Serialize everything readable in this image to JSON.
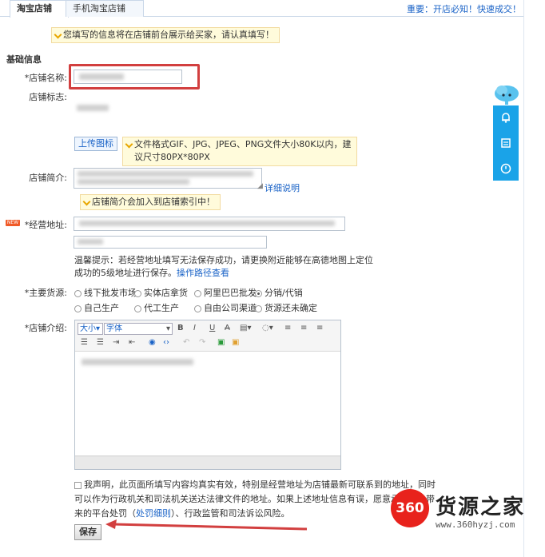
{
  "tabs": [
    {
      "label": "淘宝店铺"
    },
    {
      "label": "手机淘宝店铺"
    }
  ],
  "top_notice": "重要：开店必知！快速成交！",
  "info_tip": "您填写的信息将在店铺前台展示给买家，请认真填写！",
  "section_title": "基础信息",
  "fields": {
    "shop_name_label": "*店铺名称:",
    "shop_logo_label": "店铺标志:",
    "upload_button": "上传图标",
    "upload_tip": "文件格式GIF、JPG、JPEG、PNG文件大小80K以内，建议尺寸80PX*80PX",
    "shop_intro_label": "店铺简介:",
    "detail_link": "详细说明",
    "intro_tip": "店铺简介会加入到店铺索引中！",
    "address_label": "*经营地址:",
    "address_hint": "温馨提示：若经营地址填写无法保存成功，请更换附近能够在高德地图上定位成功的5级地址进行保存。",
    "address_hint_link": "操作路径查看",
    "source_label": "*主要货源:",
    "description_label": "*店铺介绍:"
  },
  "source_options": [
    {
      "label": "线下批发市场",
      "checked": false
    },
    {
      "label": "实体店拿货",
      "checked": false
    },
    {
      "label": "阿里巴巴批发",
      "checked": false
    },
    {
      "label": "分销/代销",
      "checked": true
    },
    {
      "label": "自己生产",
      "checked": false
    },
    {
      "label": "代工生产",
      "checked": false
    },
    {
      "label": "自由公司渠道",
      "checked": false
    },
    {
      "label": "货源还未确定",
      "checked": false
    }
  ],
  "editor": {
    "size_label": "大小",
    "font_label": "字体"
  },
  "declaration": {
    "text": "我声明，此页面所填写内容均真实有效，特别是经营地址为店铺最新可联系到的地址，同时可以作为行政机关和司法机关送达法律文件的地址。如果上述地址信息有误，愿意承担由此带来的平台处罚（",
    "link": "处罚细则",
    "text_end": "）、行政监管和司法诉讼风险。"
  },
  "save_button": "保存",
  "watermark": {
    "logo": "360",
    "name": "货源之家",
    "url": "www.360hyzj.com"
  },
  "colors": {
    "link": "#1a63c7",
    "highlight_box": "#d23f3f",
    "sidebar": "#1aa3e8",
    "tip_bg": "#fffbdb"
  }
}
